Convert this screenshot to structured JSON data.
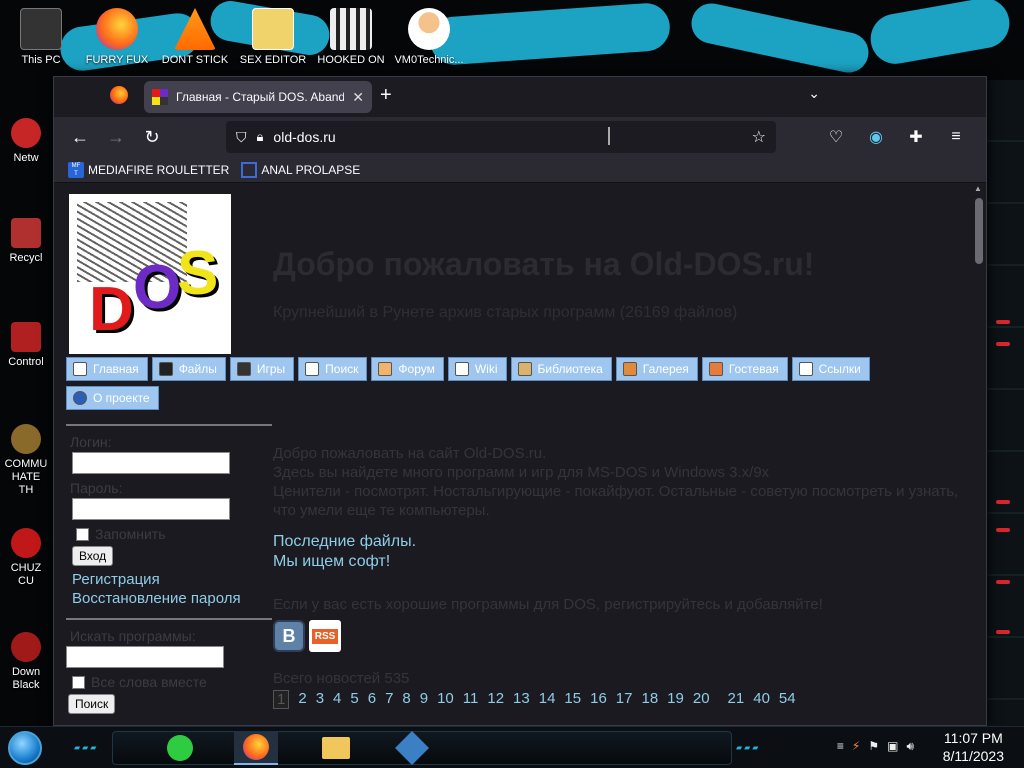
{
  "desktop": {
    "top_icons": [
      {
        "label": "This PC",
        "icon": "computer-icon",
        "color": "#444444"
      },
      {
        "label": "FURRY FUX",
        "icon": "firefox-icon",
        "color": "#ff7139"
      },
      {
        "label": "DONT STICK",
        "icon": "vlc-icon",
        "color": "#ff8800"
      },
      {
        "label": "SEX EDITOR",
        "icon": "hxd-icon",
        "color": "#e6c14d"
      },
      {
        "label": "HOOKED ON",
        "icon": "maze-icon",
        "color": "#9a9a9a"
      },
      {
        "label": "VM0Technic...",
        "icon": "doctor-icon",
        "color": "#f1a44a"
      }
    ],
    "left_icons": [
      {
        "label": "Netw",
        "icon": "network-icon",
        "color": "#c72626"
      },
      {
        "label": "Recycl",
        "icon": "recycle-bin-icon",
        "color": "#b03030"
      },
      {
        "label": "Control",
        "icon": "control-panel-icon",
        "color": "#b02020"
      },
      {
        "label": "COMMU HATE TH",
        "icon": "money-bag-icon",
        "color": "#8a6a2a"
      },
      {
        "label": "CHUZ CU",
        "icon": "red-blob-icon",
        "color": "#c01818"
      },
      {
        "label": "Down Black",
        "icon": "download-icon",
        "color": "#a01a1a"
      }
    ]
  },
  "browser": {
    "tab_title": "Главная - Старый DOS. Aband",
    "url": "old-dos.ru",
    "bookmarks": [
      "MEDIAFIRE ROULETTER",
      "ANAL PROLAPSE"
    ]
  },
  "page": {
    "title": "Добро пожаловать на Old-DOS.ru!",
    "subtitle": "Крупнейший в Рунете архив старых программ (26169 файлов)",
    "menu": [
      "Главная",
      "Файлы",
      "Игры",
      "Поиск",
      "Форум",
      "Wiki",
      "Библиотека",
      "Галерея",
      "Гостевая",
      "Ссылки",
      "О проекте"
    ],
    "login": {
      "login_label": "Логин:",
      "password_label": "Пароль:",
      "remember_label": "Запомнить",
      "submit_label": "Вход",
      "register_link": "Регистрация",
      "restore_link": "Восстановление пароля"
    },
    "search": {
      "label": "Искать программы:",
      "all_words_label": "Все слова вместе",
      "submit_label": "Поиск"
    },
    "welcome_lines": [
      "Добро пожаловать на сайт Old-DOS.ru.",
      "Здесь вы найдете много программ и игр для MS-DOS и Windows 3.x/9x",
      "Ценители - посмотрят. Ностальгирующие - покайфуют. Остальные - советую посмотреть и узнать, что умели еще те компьютеры."
    ],
    "latest_files_link": "Последние файлы.",
    "wanted_link": "Мы ищем софт!",
    "notice": "Если у вас есть хорошие программы для DOS, регистрируйтесь и добавляйте!",
    "vk_label": "В",
    "rss_label": "RSS",
    "news_total": "Всего новостей 535",
    "pages": [
      "1",
      "2",
      "3",
      "4",
      "5",
      "6",
      "7",
      "8",
      "9",
      "10",
      "11",
      "12",
      "13",
      "14",
      "15",
      "16",
      "17",
      "18",
      "19",
      "20",
      "21",
      "40",
      "54"
    ]
  },
  "taskbar": {
    "time": "11:07 PM",
    "date": "8/11/2023"
  }
}
